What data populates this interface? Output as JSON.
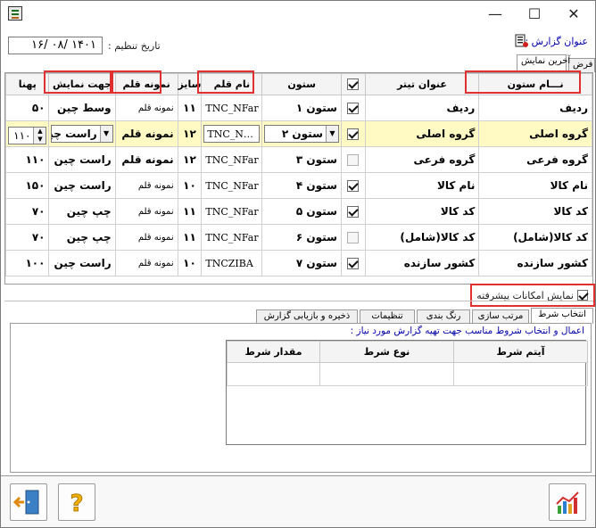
{
  "window": {
    "minimize": "—",
    "maximize": "☐",
    "close": "✕"
  },
  "header": {
    "report_title_label": "عنوان گزارش :",
    "date_label": "تاریخ تنظیم :",
    "date_value": "۱۴۰۱ /۰۸ /۱۶"
  },
  "top_tabs": [
    "پیش فرض",
    "آخرین نمایش"
  ],
  "grid": {
    "headers": [
      "نـــام ستون",
      "عنوان تیتر",
      "",
      "ستون",
      "نام قلم",
      "سایز",
      "نمونه قلم",
      "جهت نمایش",
      "پهنا"
    ],
    "rows": [
      {
        "name": "ردیف",
        "title": "ردیف",
        "checked": true,
        "column": "ستون ۱",
        "font": "TNC_NFar",
        "size": "۱۱",
        "sample": "نمونه قلم",
        "sample_bold": false,
        "align": "وسط چین",
        "width": "۵۰"
      },
      {
        "name": "گروه اصلی",
        "title": "گروه اصلی",
        "checked": true,
        "column": "ستون ۲",
        "font": "TNC_N…",
        "size": "۱۲",
        "sample": "نمونه قلم",
        "sample_bold": true,
        "align": "راست چین",
        "width": "۱۱۰"
      },
      {
        "name": "گروه فرعی",
        "title": "گروه فرعی",
        "checked": false,
        "column": "ستون ۳",
        "font": "TNC_NFar",
        "size": "۱۲",
        "sample": "نمونه قلم",
        "sample_bold": true,
        "align": "راست چین",
        "width": "۱۱۰"
      },
      {
        "name": "نام کالا",
        "title": "نام کالا",
        "checked": true,
        "column": "ستون ۴",
        "font": "TNC_NFar",
        "size": "۱۰",
        "sample": "نمونه قلم",
        "sample_bold": false,
        "align": "راست چین",
        "width": "۱۵۰"
      },
      {
        "name": "کد کالا",
        "title": "کد کالا",
        "checked": true,
        "column": "ستون ۵",
        "font": "TNC_NFar",
        "size": "۱۱",
        "sample": "نمونه قلم",
        "sample_bold": false,
        "align": "چپ چین",
        "width": "۷۰"
      },
      {
        "name": "کد کالا(شامل)",
        "title": "کد کالا(شامل)",
        "checked": false,
        "column": "ستون ۶",
        "font": "TNC_NFar",
        "size": "۱۱",
        "sample": "نمونه قلم",
        "sample_bold": false,
        "align": "چپ چین",
        "width": "۷۰"
      },
      {
        "name": "کشور سازنده",
        "title": "کشور سازنده",
        "checked": true,
        "column": "ستون ۷",
        "font": "TNCZIBA",
        "size": "۱۰",
        "sample": "نمونه قلم",
        "sample_bold": false,
        "align": "راست چین",
        "width": "۱۰۰"
      }
    ]
  },
  "advanced_options_label": "نمایش امکانات پیشرفته",
  "bottom_tabs": [
    "انتخاب شرط",
    "مرتب سازی",
    "رنگ بندی",
    "تنظیمات",
    "ذخیره و بازیابی گزارش"
  ],
  "condition_hint": "اعمال و انتخاب شروط مناسب جهت تهیه گزارش  مورد نیاز :",
  "condition_table": {
    "headers": [
      "آیتم شرط",
      "نوع شرط",
      "مقدار شرط"
    ]
  },
  "colors": {
    "highlight_border": "#e03030",
    "selected_row": "#fff9c4",
    "hint_text": "#0000aa"
  }
}
